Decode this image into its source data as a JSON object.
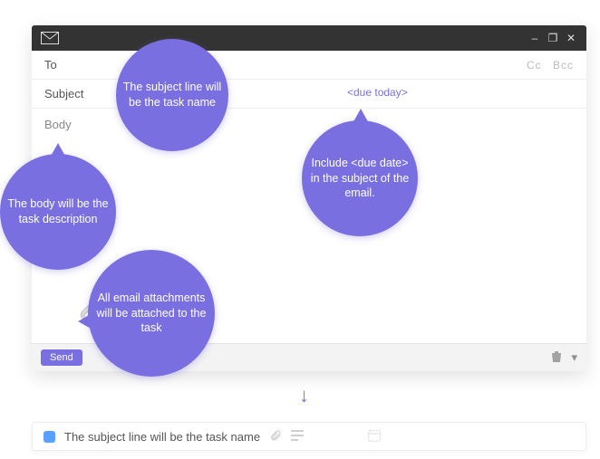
{
  "accent": "#7a6fe0",
  "email": {
    "to_label": "To",
    "subject_label": "Subject",
    "body_label": "Body",
    "cc_label": "Cc",
    "bcc_label": "Bcc",
    "due_token": "<due today>",
    "send_label": "Send",
    "window_controls": {
      "minimize": "–",
      "maximize": "❐",
      "close": "✕"
    },
    "more_label": "▾"
  },
  "annotations": {
    "subject": "The subject line will be the task name",
    "due": "Include <due date> in the subject of the email.",
    "body": "The body will be the task description",
    "attachments": "All email attachments will be attached to the task"
  },
  "arrow_glyph": "↓",
  "task": {
    "title": "The subject line will be the task name"
  }
}
